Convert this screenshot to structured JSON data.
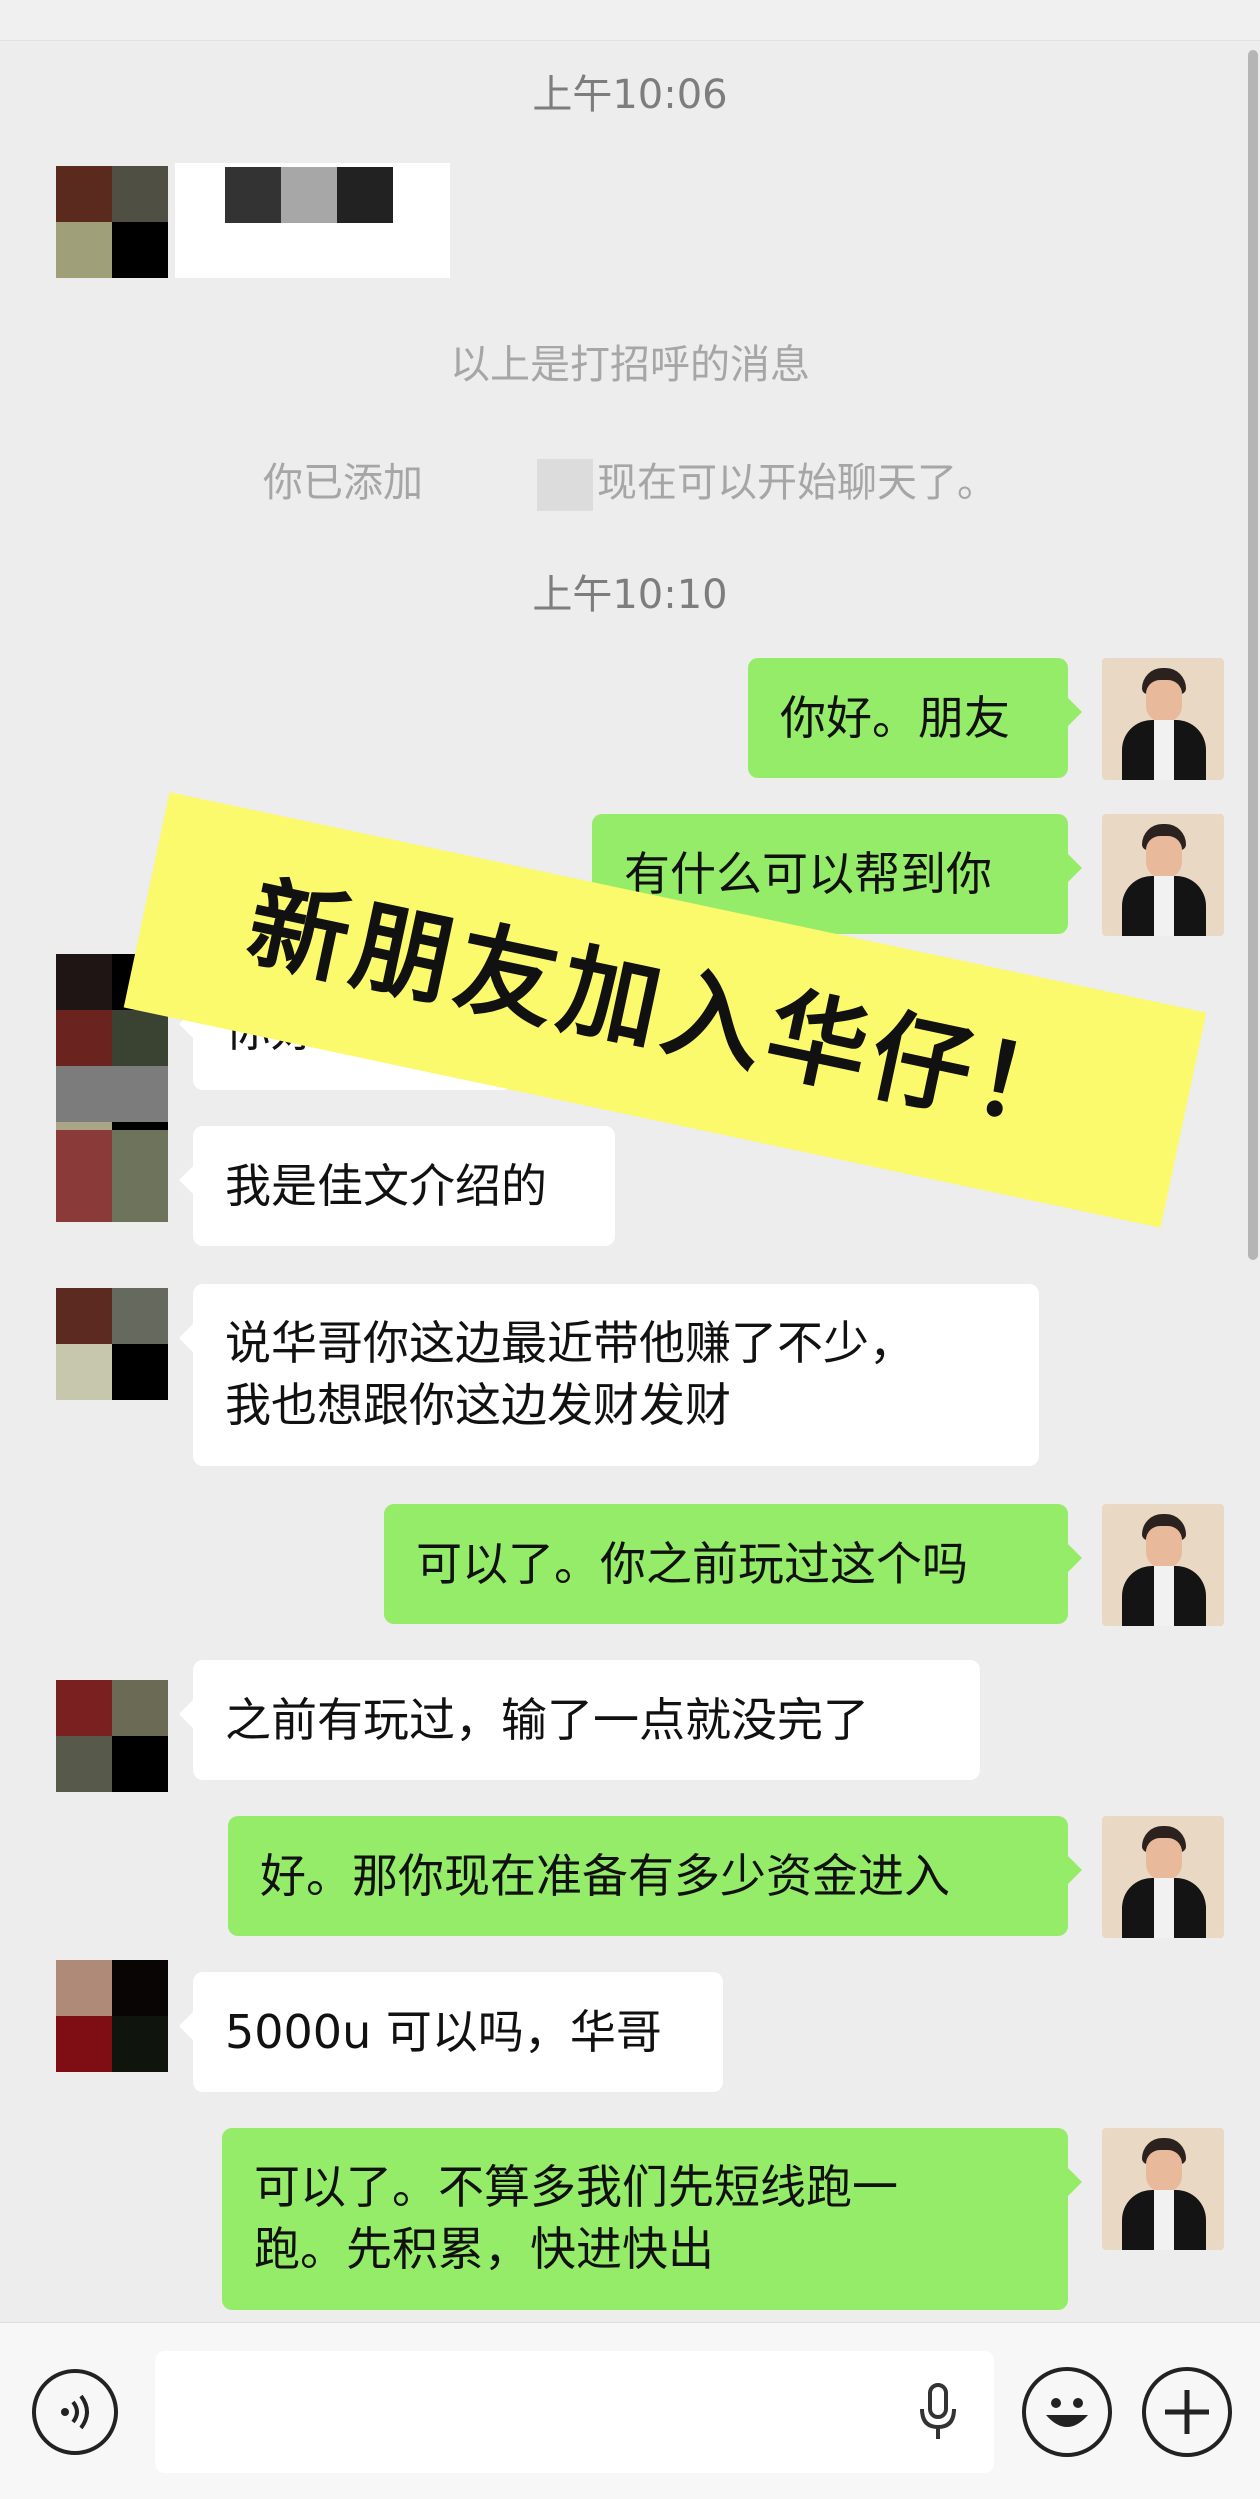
{
  "time_labels": [
    "上午10:06",
    "上午10:10"
  ],
  "system_messages": {
    "greeting": "以上是打招呼的消息",
    "added_prefix": "你已添加",
    "added_suffix": "现在可以开始聊天了。"
  },
  "banner_text": "新朋友加入华仔！",
  "messages": [
    {
      "side": "right",
      "text": "你好。朋友"
    },
    {
      "side": "right",
      "text": "有什么可以帮到你"
    },
    {
      "side": "left",
      "text": "你好。华哥"
    },
    {
      "side": "left",
      "text": "我是佳文介绍的"
    },
    {
      "side": "left",
      "text": "说华哥你这边最近带他赚了不少，"
    },
    {
      "side": "left",
      "text": "我也想跟你这边发财发财"
    },
    {
      "side": "right",
      "text": "可以了。你之前玩过这个吗"
    },
    {
      "side": "left",
      "text": "之前有玩过，输了一点就没完了"
    },
    {
      "side": "right",
      "text": "好。那你现在准备有多少资金进入"
    },
    {
      "side": "left",
      "text": "5000u 可以吗，华哥"
    },
    {
      "side": "right",
      "text": "可以了。不算多我们先短线跑一"
    },
    {
      "side": "right",
      "text": "跑。先积累，快进快出"
    }
  ],
  "input_bar": {
    "voice_icon": "voice-toggle-icon",
    "mic_icon": "microphone-icon",
    "emoji_icon": "emoji-icon",
    "plus_icon": "plus-icon",
    "placeholder": ""
  },
  "colors": {
    "background": "#ededed",
    "my_bubble": "#95ec69",
    "other_bubble": "#ffffff",
    "banner": "#fbf96c"
  }
}
